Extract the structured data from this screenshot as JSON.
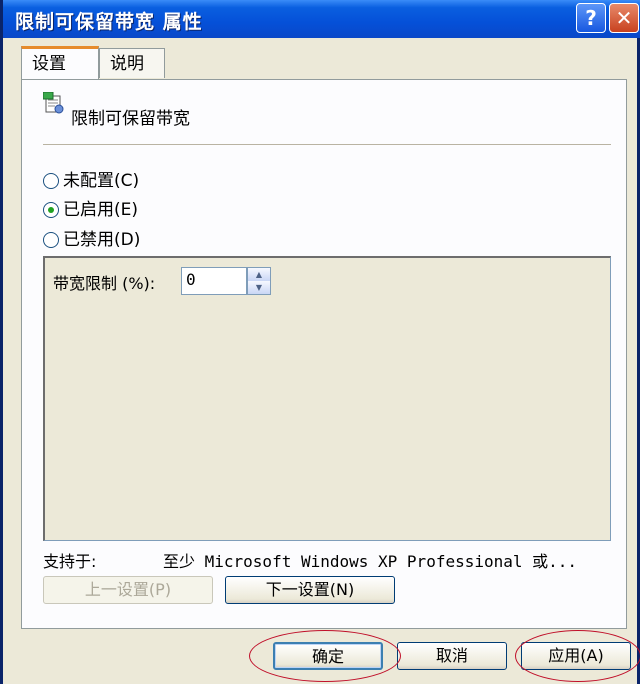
{
  "window": {
    "title": "限制可保留带宽 属性"
  },
  "title_buttons": {
    "help": "?",
    "close": "✕"
  },
  "tabs": [
    {
      "label": "设置",
      "active": true
    },
    {
      "label": "说明",
      "active": false
    }
  ],
  "policy": {
    "name": "限制可保留带宽",
    "icon": "policy-icon"
  },
  "radios": [
    {
      "label": "未配置(C)",
      "checked": false
    },
    {
      "label": "已启用(E)",
      "checked": true
    },
    {
      "label": "已禁用(D)",
      "checked": false
    }
  ],
  "option": {
    "label": "带宽限制 (%):",
    "value": "0"
  },
  "support": {
    "label": "支持于:",
    "value": "至少 Microsoft Windows XP Professional 或..."
  },
  "nav_buttons": {
    "prev": "上一设置(P)",
    "next": "下一设置(N)"
  },
  "dialog_buttons": {
    "ok": "确定",
    "cancel": "取消",
    "apply": "应用(A)"
  },
  "colors": {
    "title_bar": "#0550d8",
    "highlight_circle": "#c0102a",
    "radio_checked": "#21a121"
  }
}
